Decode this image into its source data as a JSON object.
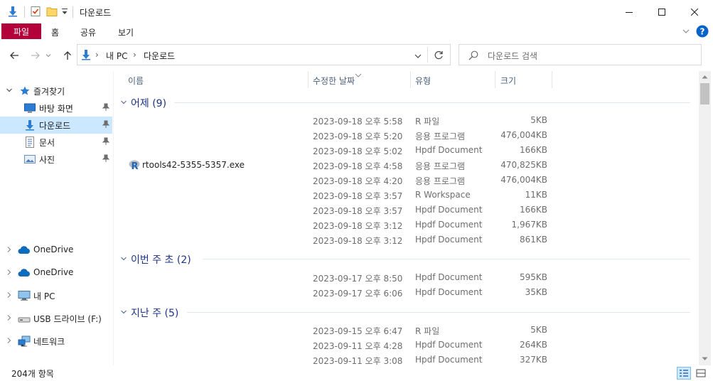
{
  "window": {
    "title": "다운로드"
  },
  "ribbon": {
    "file_label": "파일",
    "tabs": [
      "홈",
      "공유",
      "보기"
    ]
  },
  "address": {
    "crumbs": [
      "내 PC",
      "다운로드"
    ]
  },
  "search": {
    "placeholder": "다운로드 검색"
  },
  "columns": {
    "name": "이름",
    "date": "수정한 날짜",
    "type": "유형",
    "size": "크기"
  },
  "nav": {
    "quick_access": "즐겨찾기",
    "pinned": [
      {
        "label": "바탕 화면",
        "icon": "desktop-icon"
      },
      {
        "label": "다운로드",
        "icon": "download-icon",
        "selected": true
      },
      {
        "label": "문서",
        "icon": "document-icon"
      },
      {
        "label": "사진",
        "icon": "pictures-icon"
      }
    ],
    "roots": [
      {
        "label": "OneDrive",
        "icon": "onedrive-icon"
      },
      {
        "label": "OneDrive",
        "icon": "onedrive-icon"
      },
      {
        "label": "내 PC",
        "icon": "pc-icon"
      },
      {
        "label": "USB 드라이브 (F:)",
        "icon": "usb-drive-icon"
      },
      {
        "label": "네트워크",
        "icon": "network-icon"
      }
    ]
  },
  "groups": [
    {
      "title": "어제 (9)",
      "rows": [
        {
          "name": "",
          "date": "2023-09-18 오후 5:58",
          "type": "R 파일",
          "size": "5KB"
        },
        {
          "name": "",
          "date": "2023-09-18 오후 5:20",
          "type": "응용 프로그램",
          "size": "476,004KB"
        },
        {
          "name": "",
          "date": "2023-09-18 오후 5:02",
          "type": "Hpdf Document",
          "size": "166KB"
        },
        {
          "name": "rtools42-5355-5357.exe",
          "date": "2023-09-18 오후 4:58",
          "type": "응용 프로그램",
          "size": "470,825KB",
          "icon": "r-installer-icon"
        },
        {
          "name": "",
          "date": "2023-09-18 오후 4:20",
          "type": "응용 프로그램",
          "size": "476,004KB"
        },
        {
          "name": "",
          "date": "2023-09-18 오후 3:57",
          "type": "R Workspace",
          "size": "11KB"
        },
        {
          "name": "",
          "date": "2023-09-18 오후 3:57",
          "type": "Hpdf Document",
          "size": "166KB"
        },
        {
          "name": "",
          "date": "2023-09-18 오후 3:12",
          "type": "Hpdf Document",
          "size": "1,967KB"
        },
        {
          "name": "",
          "date": "2023-09-18 오후 3:12",
          "type": "Hpdf Document",
          "size": "861KB"
        }
      ]
    },
    {
      "title": "이번 주 초 (2)",
      "rows": [
        {
          "name": "",
          "date": "2023-09-17 오후 8:50",
          "type": "Hpdf Document",
          "size": "595KB"
        },
        {
          "name": "",
          "date": "2023-09-17 오후 6:06",
          "type": "Hpdf Document",
          "size": "35KB"
        }
      ]
    },
    {
      "title": "지난 주 (5)",
      "rows": [
        {
          "name": "",
          "date": "2023-09-15 오후 6:47",
          "type": "R 파일",
          "size": "5KB"
        },
        {
          "name": "",
          "date": "2023-09-11 오후 4:28",
          "type": "Hpdf Document",
          "size": "264KB"
        },
        {
          "name": "",
          "date": "2023-09-11 오후 3:08",
          "type": "Hpdf Document",
          "size": "327KB"
        }
      ]
    }
  ],
  "status": {
    "count": "204개 항목"
  },
  "colors": {
    "accent_file_tab": "#b3003b",
    "selection": "#cce8ff",
    "group_title": "#1e3287"
  }
}
